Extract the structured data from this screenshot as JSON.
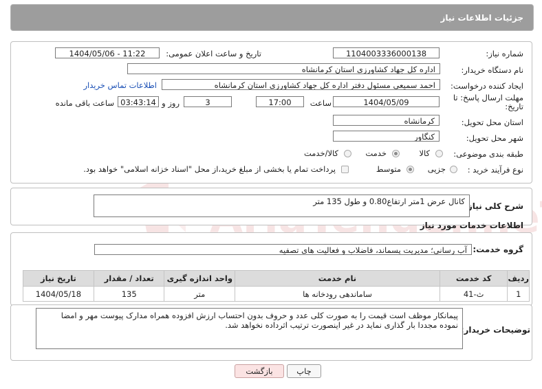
{
  "header": {
    "title": "جزئیات اطلاعات نیاز"
  },
  "fields": {
    "need_number_label": "شماره نیاز:",
    "need_number": "1104003336000138",
    "announce_label": "تاریخ و ساعت اعلان عمومی:",
    "announce_value": "1404/05/06 - 11:22",
    "buyer_label": "نام دستگاه خریدار:",
    "buyer_value": "اداره کل جهاد کشاورزی استان کرمانشاه",
    "creator_label": "ایجاد کننده درخواست:",
    "creator_value": "احمد سمیعی مسئول دفتر اداره کل جهاد کشاورزی استان کرمانشاه",
    "contact_link": "اطلاعات تماس خریدار",
    "deadline_label": "مهلت ارسال پاسخ: تا تاریخ:",
    "deadline_date": "1404/05/09",
    "time_label": "ساعت",
    "deadline_time": "17:00",
    "days_value": "3",
    "days_label": "روز و",
    "remaining_time": "03:43:14",
    "remaining_label": "ساعت باقی مانده",
    "province_label": "استان محل تحویل:",
    "province_value": "کرمانشاه",
    "city_label": "شهر محل تحویل:",
    "city_value": "کنگاور",
    "category_label": "طبقه بندی موضوعی:",
    "category_options": [
      "کالا",
      "خدمت",
      "کالا/خدمت"
    ],
    "category_selected": "خدمت",
    "process_label": "نوع فرآیند خرید :",
    "process_options": [
      "جزیی",
      "متوسط"
    ],
    "process_selected": "متوسط",
    "payment_note": "پرداخت تمام یا بخشی از مبلغ خرید،از محل \"اسناد خزانه اسلامی\" خواهد بود."
  },
  "summary": {
    "label": "شرح کلی نیاز:",
    "text": "کانال عرض 1متر ارتفاع0.80 و طول 135 متر"
  },
  "services_section": {
    "title": "اطلاعات خدمات مورد نیاز",
    "group_label": "گروه خدمت:",
    "group_value": "آب رسانی؛ مدیریت پسماند، فاضلاب و فعالیت های تصفیه",
    "columns": [
      "ردیف",
      "کد خدمت",
      "نام خدمت",
      "واحد اندازه گیری",
      "تعداد / مقدار",
      "تاریخ نیاز"
    ],
    "rows": [
      [
        "1",
        "ث-41",
        "ساماندهی رودخانه ها",
        "متر",
        "135",
        "1404/05/18"
      ]
    ]
  },
  "buyer_notes": {
    "label": "توضیحات خریدار:",
    "text": "پیمانکار موظف است قیمت را به صورت کلی عدد و حروف بدون احتساب ارزش افزوده همراه مدارک پیوست مهر و امضا نموده مجددا بار گذاری نماید در غیر اینصورت ترتیب اثرداده نخواهد شد."
  },
  "buttons": {
    "print": "چاپ",
    "back": "بازگشت"
  },
  "watermark": {
    "text": "AriaTender.neT"
  },
  "colors": {
    "header_bg": "#9d9d9d",
    "link": "#1a4fb5",
    "back_btn_bg": "#fbe3e3",
    "watermark": "#e9b3b3"
  }
}
